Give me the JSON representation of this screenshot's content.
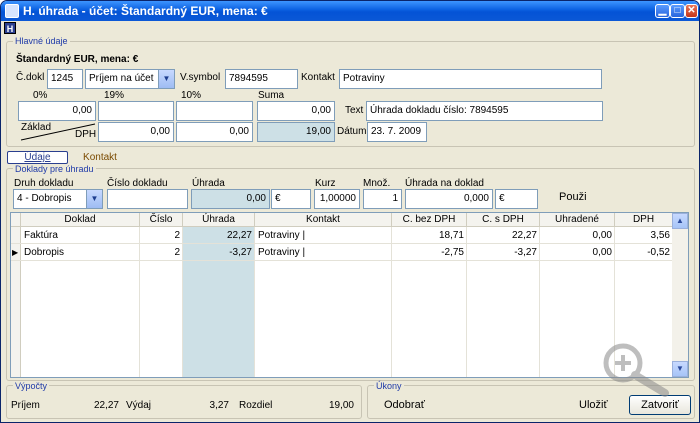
{
  "window": {
    "title": "H. úhrada - účet: Štandardný EUR, mena: €",
    "menu_letter": "H"
  },
  "header_group": {
    "title": "Hlavné údaje",
    "account_line": "Štandardný EUR, mena: €",
    "doc_no_label": "Č.dokl",
    "doc_no": "1245",
    "doc_type": "Príjem na účet",
    "vsymbol_label": "V.symbol",
    "vsymbol": "7894595",
    "contact_label": "Kontakt",
    "contact": "Potraviny",
    "vat_headers": [
      "0%",
      "19%",
      "10%",
      "Suma"
    ],
    "base_values": [
      "0,00",
      "",
      "",
      "0,00"
    ],
    "vat_values": [
      "0,00",
      "0,00",
      "19,00"
    ],
    "base_label": "Základ",
    "vat_label": "DPH",
    "text_label": "Text",
    "text": "Úhrada dokladu číslo: 7894595",
    "date_label": "Dátum",
    "date": "23. 7. 2009"
  },
  "tabs": [
    {
      "label": "Údaje"
    },
    {
      "label": "Kontakt"
    }
  ],
  "docs_group": {
    "title": "Doklady pre úhradu",
    "type_label": "Druh dokladu",
    "type_value": "4 - Dobropis",
    "docno_label": "Číslo dokladu",
    "docno_value": "",
    "payment_label": "Úhrada",
    "payment_value": "0,00",
    "currency": "€",
    "rate_label": "Kurz",
    "rate_value": "1,00000",
    "qty_label": "Množ.",
    "qty_value": "1",
    "paydoc_label": "Úhrada na doklad",
    "paydoc_value": "0,000",
    "paydoc_currency": "€",
    "use_label": "Použi"
  },
  "grid": {
    "columns": [
      "Doklad",
      "Číslo",
      "Úhrada",
      "Kontakt",
      "C. bez DPH",
      "C. s DPH",
      "Uhradené",
      "DPH"
    ],
    "rows": [
      [
        "Faktúra",
        "2",
        "22,27",
        "Potraviny |",
        "18,71",
        "22,27",
        "0,00",
        "3,56"
      ],
      [
        "Dobropis",
        "2",
        "-3,27",
        "Potraviny |",
        "-2,75",
        "-3,27",
        "0,00",
        "-0,52"
      ]
    ]
  },
  "calc_group": {
    "title": "Výpočty",
    "income_label": "Príjem",
    "income": "22,27",
    "expense_label": "Výdaj",
    "expense": "3,27",
    "diff_label": "Rozdiel",
    "diff": "19,00"
  },
  "actions_group": {
    "title": "Úkony",
    "discard_label": "Odobrať",
    "save_label": "Uložiť",
    "close_label": "Zatvoriť"
  },
  "colors": {
    "titlebar": "#0453d6",
    "accent_label": "#1f3aa8",
    "readonly_fill": "#cde0e6"
  }
}
